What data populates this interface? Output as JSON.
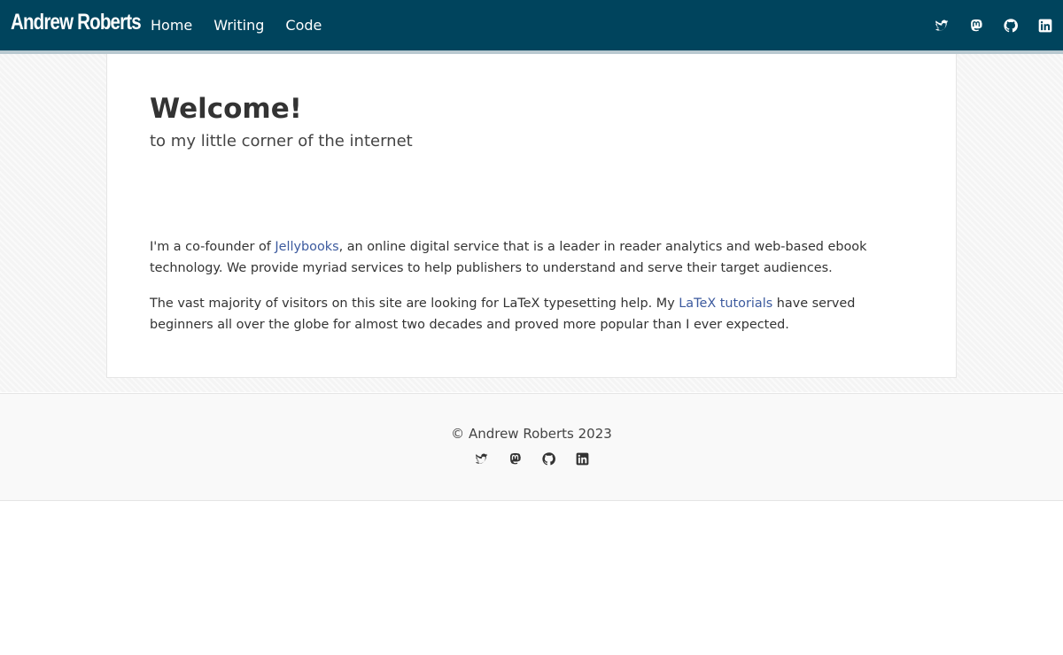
{
  "header": {
    "brand": "Andrew Roberts",
    "nav": [
      {
        "label": "Home"
      },
      {
        "label": "Writing"
      },
      {
        "label": "Code"
      }
    ],
    "social_icons": [
      "twitter-icon",
      "mastodon-icon",
      "github-icon",
      "linkedin-icon"
    ]
  },
  "main": {
    "title": "Welcome!",
    "subtitle": "to my little corner of the internet",
    "para1": {
      "before": "I'm a co-founder of ",
      "link": "Jellybooks",
      "after": ", an online digital service that is a leader in reader analytics and web-based ebook technology. We provide myriad services to help publishers to understand and serve their target audiences."
    },
    "para2": {
      "before": "The vast majority of visitors on this site are looking for LaTeX typesetting help. My ",
      "link": "LaTeX tutorials",
      "after": " have served beginners all over the globe for almost two decades and proved more popular than I ever expected."
    }
  },
  "footer": {
    "copyright": "© Andrew Roberts 2023",
    "social_icons": [
      "twitter-icon",
      "mastodon-icon",
      "github-icon",
      "linkedin-icon"
    ]
  },
  "colors": {
    "navbar": "#00445d",
    "link": "#3c5a9e",
    "text": "#333333"
  }
}
